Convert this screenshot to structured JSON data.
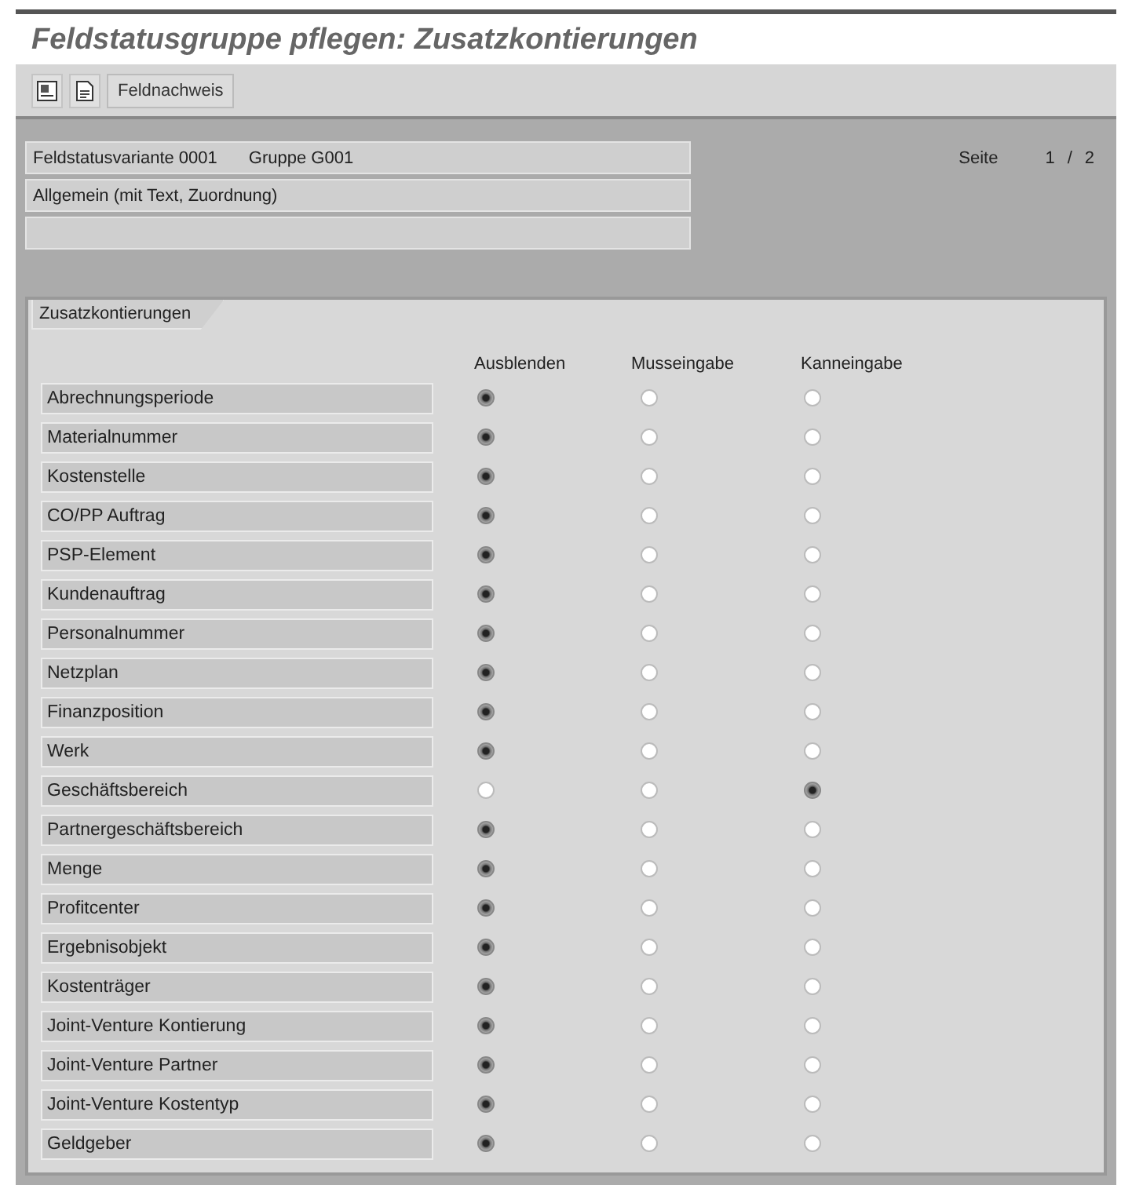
{
  "window": {
    "title": "Feldstatusgruppe pflegen: Zusatzkontierungen"
  },
  "toolbar": {
    "button": "Feldnachweis"
  },
  "header_fields": [
    {
      "kind": "text",
      "texts": [
        "Feldstatusvariante 0001",
        "Gruppe G001"
      ]
    },
    {
      "kind": "text",
      "texts": [
        "Allgemein (mit Text, Zuordnung)"
      ]
    },
    {
      "kind": "empty"
    }
  ],
  "page": {
    "label": "Seite",
    "current": "1",
    "separator": "/",
    "total": "2"
  },
  "group": {
    "tab": "Zusatzkontierungen",
    "columns": [
      "Ausblenden",
      "Musseingabe",
      "Kanneingabe"
    ],
    "rows": [
      {
        "label": "Abrechnungsperiode",
        "options": [
          {
            "selected": true
          },
          {
            "selected": false
          },
          {
            "selected": false
          }
        ]
      },
      {
        "label": "Materialnummer",
        "options": [
          {
            "selected": true
          },
          {
            "selected": false
          },
          {
            "selected": false
          }
        ]
      },
      {
        "label": "Kostenstelle",
        "options": [
          {
            "selected": true
          },
          {
            "selected": false
          },
          {
            "selected": false
          }
        ]
      },
      {
        "label": "CO/PP Auftrag",
        "options": [
          {
            "selected": true
          },
          {
            "selected": false
          },
          {
            "selected": false
          }
        ]
      },
      {
        "label": "PSP-Element",
        "options": [
          {
            "selected": true
          },
          {
            "selected": false
          },
          {
            "selected": false
          }
        ]
      },
      {
        "label": "Kundenauftrag",
        "options": [
          {
            "selected": true
          },
          {
            "selected": false
          },
          {
            "selected": false
          }
        ]
      },
      {
        "label": "Personalnummer",
        "options": [
          {
            "selected": true
          },
          {
            "selected": false
          },
          {
            "selected": false
          }
        ]
      },
      {
        "label": "Netzplan",
        "options": [
          {
            "selected": true
          },
          {
            "selected": false
          },
          {
            "selected": false
          }
        ]
      },
      {
        "label": "Finanzposition",
        "options": [
          {
            "selected": true
          },
          {
            "selected": false
          },
          {
            "selected": false
          }
        ]
      },
      {
        "label": "Werk",
        "options": [
          {
            "selected": true
          },
          {
            "selected": false
          },
          {
            "selected": false
          }
        ]
      },
      {
        "label": "Geschäftsbereich",
        "options": [
          {
            "selected": false
          },
          {
            "selected": false
          },
          {
            "selected": true
          }
        ]
      },
      {
        "label": "Partnergeschäftsbereich",
        "options": [
          {
            "selected": true
          },
          {
            "selected": false
          },
          {
            "selected": false
          }
        ]
      },
      {
        "label": "Menge",
        "options": [
          {
            "selected": true
          },
          {
            "selected": false
          },
          {
            "selected": false
          }
        ]
      },
      {
        "label": "Profitcenter",
        "options": [
          {
            "selected": true
          },
          {
            "selected": false
          },
          {
            "selected": false
          }
        ]
      },
      {
        "label": "Ergebnisobjekt",
        "options": [
          {
            "selected": true
          },
          {
            "selected": false
          },
          {
            "selected": false
          }
        ]
      },
      {
        "label": "Kostenträger",
        "options": [
          {
            "selected": true
          },
          {
            "selected": false
          },
          {
            "selected": false
          }
        ]
      },
      {
        "label": "Joint-Venture Kontierung",
        "options": [
          {
            "selected": true
          },
          {
            "selected": false
          },
          {
            "selected": false
          }
        ]
      },
      {
        "label": "Joint-Venture Partner",
        "options": [
          {
            "selected": true
          },
          {
            "selected": false
          },
          {
            "selected": false
          }
        ]
      },
      {
        "label": "Joint-Venture Kostentyp",
        "options": [
          {
            "selected": true
          },
          {
            "selected": false
          },
          {
            "selected": false
          }
        ]
      },
      {
        "label": "Geldgeber",
        "options": [
          {
            "selected": true
          },
          {
            "selected": false
          },
          {
            "selected": false
          }
        ]
      }
    ]
  }
}
